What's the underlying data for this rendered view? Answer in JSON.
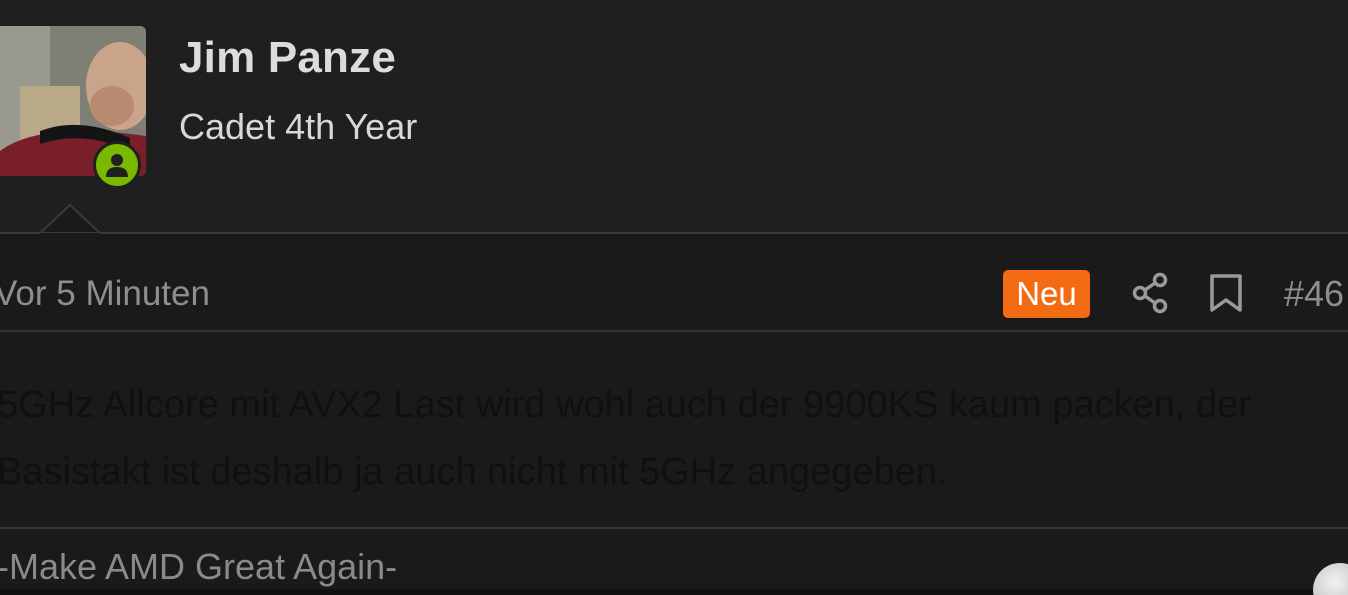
{
  "user": {
    "name": "Jim Panze",
    "rank": "Cadet 4th Year"
  },
  "post": {
    "time": "Vor 5 Minuten",
    "badge": "Neu",
    "number": "#46",
    "content_lines": [
      "5GHz Allcore mit AVX2 Last wird wohl auch der 9900KS kaum packen, der",
      "Basistakt ist deshalb ja auch nicht mit 5GHz angegeben."
    ],
    "signature": "-Make AMD Great Again-"
  },
  "icons": {
    "online": "user-online-icon",
    "share": "share-icon",
    "bookmark": "bookmark-icon"
  },
  "colors": {
    "background": "#1e1e1e",
    "badge": "#f36b12",
    "online": "#7ab800"
  }
}
